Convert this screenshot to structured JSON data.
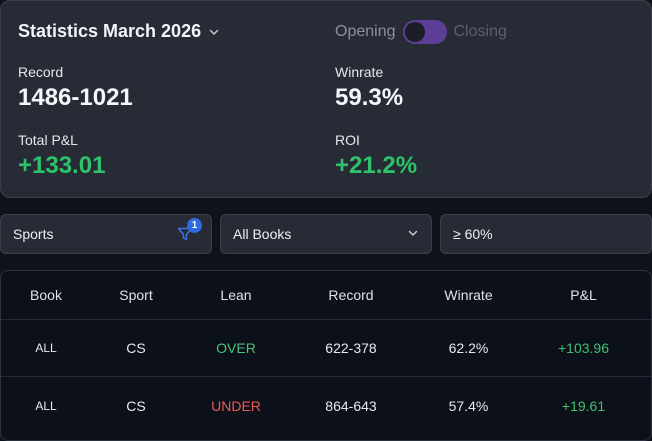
{
  "stats": {
    "title": "Statistics March 2026",
    "toggle": {
      "left_label": "Opening",
      "right_label": "Closing",
      "state": "opening"
    },
    "record_label": "Record",
    "record_value": "1486-1021",
    "winrate_label": "Winrate",
    "winrate_value": "59.3%",
    "pnl_label": "Total P&L",
    "pnl_value": "+133.01",
    "roi_label": "ROI",
    "roi_value": "+21.2%"
  },
  "filters": {
    "sports": {
      "label": "Sports",
      "badge": "1"
    },
    "books": {
      "label": "All Books"
    },
    "winrate": {
      "label": "≥ 60%"
    }
  },
  "table": {
    "headers": [
      "Book",
      "Sport",
      "Lean",
      "Record",
      "Winrate",
      "P&L"
    ],
    "rows": [
      {
        "book": "ALL",
        "sport": "CS",
        "lean": "OVER",
        "record": "622-378",
        "winrate": "62.2%",
        "pnl": "+103.96"
      },
      {
        "book": "ALL",
        "sport": "CS",
        "lean": "UNDER",
        "record": "864-643",
        "winrate": "57.4%",
        "pnl": "+19.61"
      }
    ]
  },
  "colors": {
    "positive": "#2ec36a",
    "negative": "#ec5a56",
    "toggle": "#5b3f95",
    "badge": "#2e6ae0"
  }
}
